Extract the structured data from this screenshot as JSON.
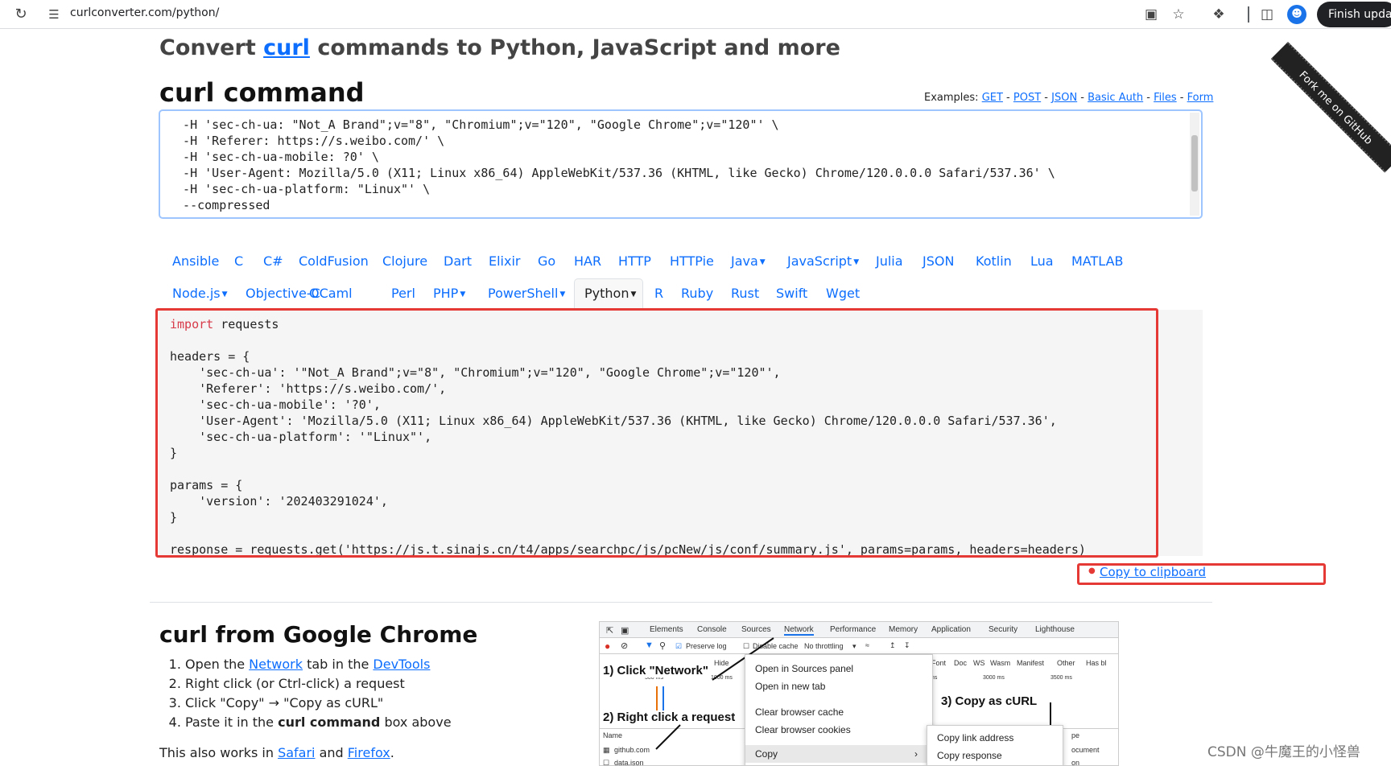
{
  "browser": {
    "url": "curlconverter.com/python/",
    "finish_label": "Finish upda",
    "avatar_initial": "☻"
  },
  "ribbon": {
    "text": "Fork me on GitHub"
  },
  "header": {
    "lead_pre": "Convert ",
    "lead_link": "curl",
    "lead_post": " commands to Python, JavaScript and more",
    "curl_title": "curl command"
  },
  "examples": {
    "label": "Examples: ",
    "items": [
      "GET",
      "POST",
      "JSON",
      "Basic Auth",
      "Files",
      "Form"
    ],
    "sep": " - "
  },
  "curl_input": {
    "text": "  -H 'sec-ch-ua: \"Not_A Brand\";v=\"8\", \"Chromium\";v=\"120\", \"Google Chrome\";v=\"120\"' \\\n  -H 'Referer: https://s.weibo.com/' \\\n  -H 'sec-ch-ua-mobile: ?0' \\\n  -H 'User-Agent: Mozilla/5.0 (X11; Linux x86_64) AppleWebKit/537.36 (KHTML, like Gecko) Chrome/120.0.0.0 Safari/537.36' \\\n  -H 'sec-ch-ua-platform: \"Linux\"' \\\n  --compressed"
  },
  "languages_row1": [
    {
      "label": "Ansible"
    },
    {
      "label": "C"
    },
    {
      "label": "C#"
    },
    {
      "label": "ColdFusion"
    },
    {
      "label": "Clojure"
    },
    {
      "label": "Dart"
    },
    {
      "label": "Elixir"
    },
    {
      "label": "Go"
    },
    {
      "label": "HAR"
    },
    {
      "label": "HTTP"
    },
    {
      "label": "HTTPie"
    },
    {
      "label": "Java",
      "dropdown": true
    },
    {
      "label": "JavaScript",
      "dropdown": true
    },
    {
      "label": "Julia"
    },
    {
      "label": "JSON"
    },
    {
      "label": "Kotlin"
    },
    {
      "label": "Lua"
    },
    {
      "label": "MATLAB"
    }
  ],
  "languages_row2": [
    {
      "label": "Node.js",
      "dropdown": true
    },
    {
      "label": "Objective-C"
    },
    {
      "label": "OCaml"
    },
    {
      "label": "Perl"
    },
    {
      "label": "PHP",
      "dropdown": true
    },
    {
      "label": "PowerShell",
      "dropdown": true
    },
    {
      "label": "Python",
      "dropdown": true,
      "active": true
    },
    {
      "label": "R"
    },
    {
      "label": "Ruby"
    },
    {
      "label": "Rust"
    },
    {
      "label": "Swift"
    },
    {
      "label": "Wget"
    }
  ],
  "code": {
    "keyword": "import",
    "first_line_rest": " requests",
    "body": "\nheaders = {\n    'sec-ch-ua': '\"Not_A Brand\";v=\"8\", \"Chromium\";v=\"120\", \"Google Chrome\";v=\"120\"',\n    'Referer': 'https://s.weibo.com/',\n    'sec-ch-ua-mobile': '?0',\n    'User-Agent': 'Mozilla/5.0 (X11; Linux x86_64) AppleWebKit/537.36 (KHTML, like Gecko) Chrome/120.0.0.0 Safari/537.36',\n    'sec-ch-ua-platform': '\"Linux\"',\n}\n\nparams = {\n    'version': '202403291024',\n}\n\nresponse = requests.get('https://js.t.sinajs.cn/t4/apps/searchpc/js/pcNew/js/conf/summary.js', params=params, headers=headers)"
  },
  "copy": {
    "label": "Copy to clipboard"
  },
  "chrome_section": {
    "title": "curl from Google Chrome",
    "step1_pre": "Open the ",
    "step1_link1": "Network",
    "step1_mid": " tab in the ",
    "step1_link2": "DevTools",
    "step2": "Right click (or Ctrl-click) a request",
    "step3": "Click \"Copy\" → \"Copy as cURL\"",
    "step4_pre": "Paste it in the ",
    "step4_bold": "curl command",
    "step4_post": " box above",
    "also_pre": "This also works in ",
    "also_link1": "Safari",
    "also_mid": " and ",
    "also_link2": "Firefox",
    "also_post": "."
  },
  "devtools_image": {
    "tabs": [
      "Elements",
      "Console",
      "Sources",
      "Network",
      "Performance",
      "Memory",
      "Application",
      "Security",
      "Lighthouse"
    ],
    "preserve_log": "Preserve log",
    "disable_cache": "Disable cache",
    "throttling": "No throttling",
    "filters": [
      "Font",
      "Doc",
      "WS",
      "Wasm",
      "Manifest",
      "Other"
    ],
    "has_blocked": "Has bl",
    "hide_prefix": "Hide",
    "timeline": [
      "500 ms",
      "1000 ms",
      "3000 ms",
      "3500 ms"
    ],
    "callout1": "1) Click \"Network\"",
    "callout2": "2) Right click a request",
    "callout3": "3) Copy as cURL",
    "name_header": "Name",
    "type_header": "pe",
    "rows": [
      "github.com",
      "data.json"
    ],
    "type_cells": [
      "ocument",
      "on"
    ],
    "menu1": [
      "Open in Sources panel",
      "Open in new tab",
      "Clear browser cache",
      "Clear browser cookies",
      "Copy"
    ],
    "menu2": [
      "Copy link address",
      "Copy response"
    ],
    "ms_label": "ms"
  },
  "watermark": "CSDN @牛魔王的小怪兽"
}
